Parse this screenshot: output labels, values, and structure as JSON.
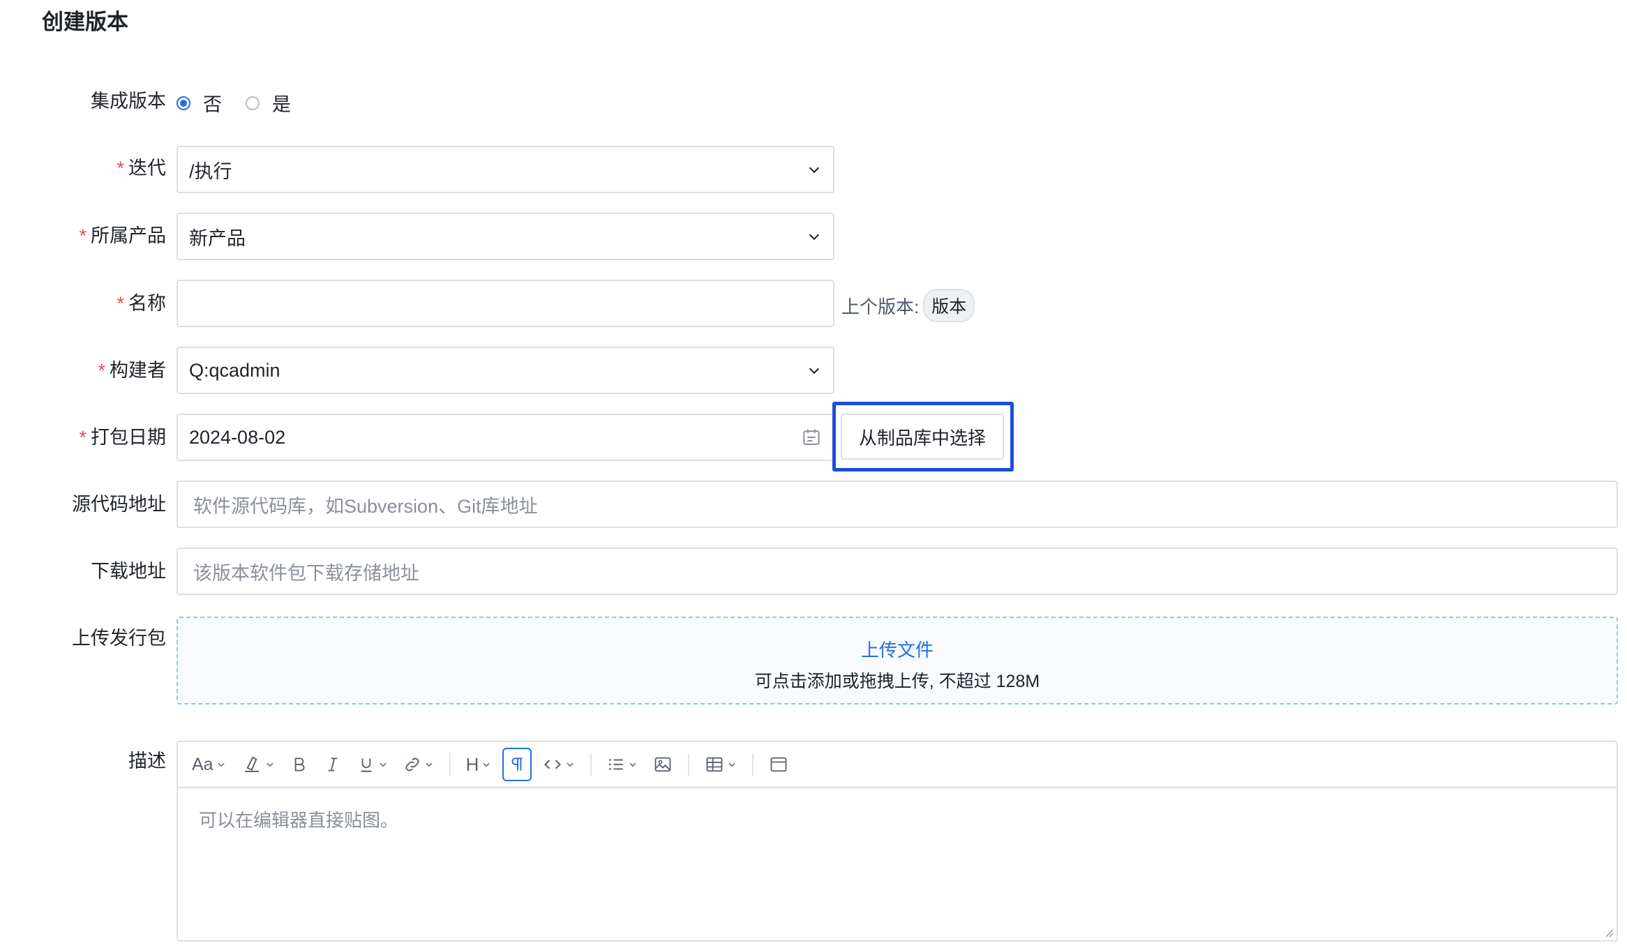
{
  "page": {
    "title": "创建版本"
  },
  "form": {
    "integrated": {
      "label": "集成版本",
      "options": [
        {
          "label": "否",
          "selected": true
        },
        {
          "label": "是",
          "selected": false
        }
      ]
    },
    "iteration": {
      "label": "迭代",
      "required": true,
      "value": "/执行"
    },
    "product": {
      "label": "所属产品",
      "required": true,
      "value": "新产品"
    },
    "name": {
      "label": "名称",
      "required": true,
      "value": "",
      "prev_label": "上个版本:",
      "prev_tag": "版本"
    },
    "builder": {
      "label": "构建者",
      "required": true,
      "value": "Q:qcadmin"
    },
    "pack_date": {
      "label": "打包日期",
      "required": true,
      "value": "2024-08-02",
      "pick_button": "从制品库中选择"
    },
    "source": {
      "label": "源代码地址",
      "value": "",
      "placeholder": "软件源代码库，如Subversion、Git库地址"
    },
    "download": {
      "label": "下载地址",
      "value": "",
      "placeholder": "该版本软件包下载存储地址"
    },
    "upload": {
      "label": "上传发行包",
      "link": "上传文件",
      "hint": "可点击添加或拖拽上传, 不超过 128M"
    },
    "description": {
      "label": "描述",
      "placeholder": "可以在编辑器直接贴图。",
      "toolbar": {
        "font_size": "Aa",
        "heading": "H",
        "icons": [
          "font-size-icon",
          "highlight-icon",
          "bold-icon",
          "italic-icon",
          "underline-icon",
          "link-icon",
          "heading-icon",
          "paragraph-icon",
          "code-icon",
          "list-icon",
          "image-icon",
          "table-icon",
          "layout-icon"
        ]
      }
    }
  },
  "colors": {
    "accent": "#1f6fe5",
    "required": "#e34d59",
    "highlight_frame": "#1c4fd6",
    "border": "#dcdfe6"
  }
}
